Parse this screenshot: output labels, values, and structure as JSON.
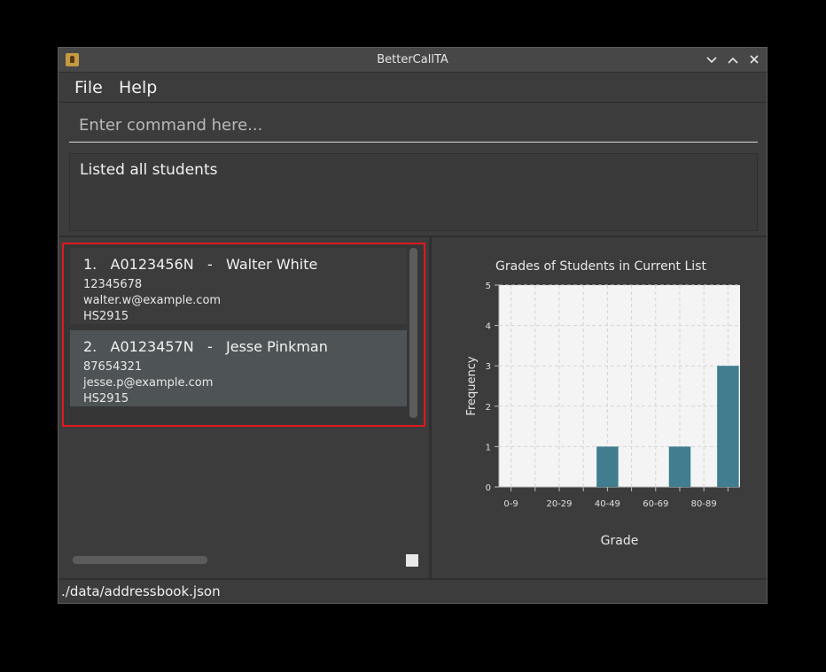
{
  "window": {
    "title": "BetterCallTA",
    "controls": [
      "chevron-down-icon",
      "chevron-up-icon",
      "close-icon"
    ]
  },
  "menu": {
    "file": "File",
    "help": "Help"
  },
  "command": {
    "placeholder": "Enter command here...",
    "value": ""
  },
  "result": {
    "message": "Listed all students"
  },
  "students": [
    {
      "index": "1.",
      "id": "A0123456N",
      "sep": "-",
      "name": "Walter White",
      "phone": "12345678",
      "email": "walter.w@example.com",
      "group": "HS2915"
    },
    {
      "index": "2.",
      "id": "A0123457N",
      "sep": "-",
      "name": "Jesse Pinkman",
      "phone": "87654321",
      "email": "jesse.p@example.com",
      "group": "HS2915"
    }
  ],
  "status": {
    "path": "./data/addressbook.json"
  },
  "colors": {
    "bar": "#3f7d8f",
    "selection_outline": "#e0181f",
    "plot_bg": "#f4f4f4"
  },
  "chart_data": {
    "type": "bar",
    "title": "Grades of Students in Current List",
    "xlabel": "Grade",
    "ylabel": "Frequency",
    "categories": [
      "0-9",
      "10-19",
      "20-29",
      "30-39",
      "40-49",
      "50-59",
      "60-69",
      "70-79",
      "80-89",
      "90-100"
    ],
    "tick_labels": [
      "0-9",
      "",
      "20-29",
      "",
      "40-49",
      "",
      "60-69",
      "",
      "80-89",
      ""
    ],
    "values": [
      0,
      0,
      0,
      0,
      1,
      0,
      0,
      1,
      0,
      3
    ],
    "ylim": [
      0,
      5
    ],
    "yticks": [
      0,
      1,
      2,
      3,
      4,
      5
    ],
    "grid": true,
    "legend": "none"
  }
}
